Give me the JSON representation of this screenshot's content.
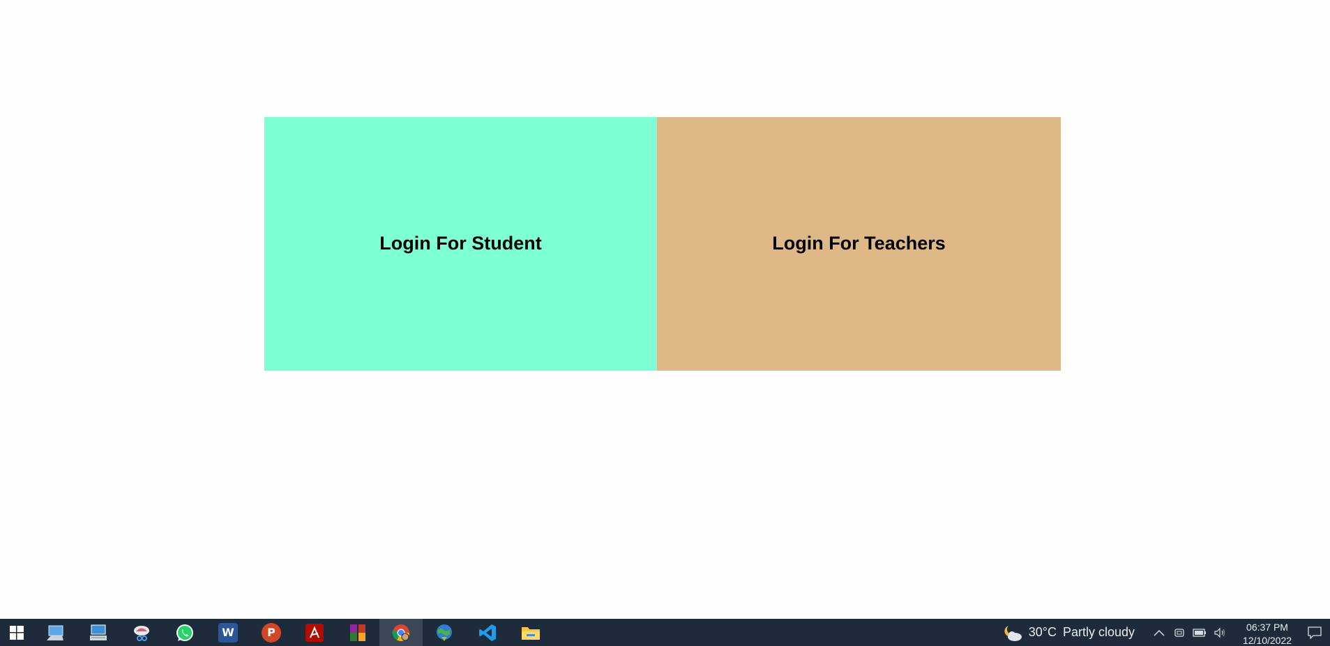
{
  "main": {
    "student_login_label": "Login For Student",
    "teacher_login_label": "Login For Teachers",
    "student_panel_color": "#7fffd4",
    "teacher_panel_color": "#deb887",
    "background_color": "#fefefe"
  },
  "taskbar": {
    "background_color": "#1e2b3a",
    "apps": [
      {
        "name": "start-menu",
        "icon": "windows-logo-icon"
      },
      {
        "name": "this-pc",
        "icon": "computer-icon"
      },
      {
        "name": "control-panel",
        "icon": "keyboard-computer-icon"
      },
      {
        "name": "snipping-tool",
        "icon": "scissors-icon"
      },
      {
        "name": "whatsapp",
        "icon": "whatsapp-icon"
      },
      {
        "name": "word",
        "icon": "word-icon",
        "letter": "W"
      },
      {
        "name": "powerpoint",
        "icon": "powerpoint-icon",
        "letter": "P"
      },
      {
        "name": "acrobat",
        "icon": "acrobat-icon"
      },
      {
        "name": "winrar",
        "icon": "winrar-icon"
      },
      {
        "name": "chrome",
        "icon": "chrome-icon",
        "active": true
      },
      {
        "name": "internet-download-manager",
        "icon": "globe-download-icon"
      },
      {
        "name": "vscode",
        "icon": "vscode-icon"
      },
      {
        "name": "file-explorer",
        "icon": "folder-icon"
      }
    ],
    "weather": {
      "temperature": "30°C",
      "condition": "Partly cloudy",
      "icon": "partly-cloudy-night-icon"
    },
    "tray_icons": [
      "chevron-up-icon",
      "meet-now-icon",
      "battery-icon",
      "speaker-icon"
    ],
    "clock": {
      "time": "06:37 PM",
      "date": "12/10/2022"
    }
  }
}
